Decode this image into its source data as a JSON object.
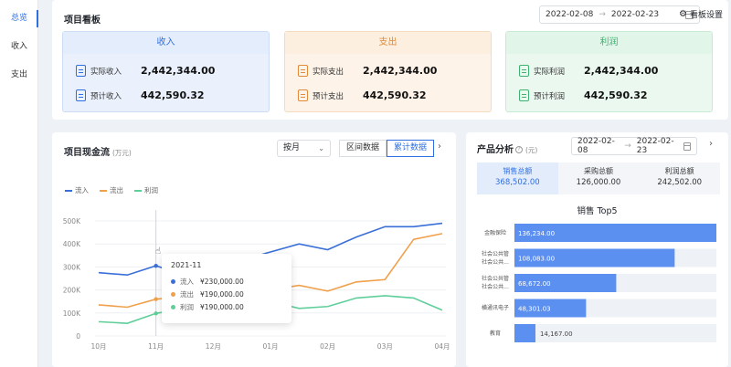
{
  "sidebar": {
    "items": [
      {
        "label": "总览",
        "active": true
      },
      {
        "label": "收入",
        "active": false
      },
      {
        "label": "支出",
        "active": false
      }
    ]
  },
  "board": {
    "title": "项目看板",
    "date_start": "2022-02-08",
    "date_end": "2022-02-23",
    "date_sep": "→",
    "settings_label": "看板设置",
    "cards": [
      {
        "title": "收入",
        "actual_label": "实际收入",
        "actual_value": "2,442,344.00",
        "plan_label": "预计收入",
        "plan_value": "442,590.32",
        "bg": "#eaf1fc",
        "head": "#e4edfb",
        "border": "#cddcf5",
        "accent": "#2f6fe0",
        "icon": "document-icon"
      },
      {
        "title": "支出",
        "actual_label": "实际支出",
        "actual_value": "2,442,344.00",
        "plan_label": "预计支出",
        "plan_value": "442,590.32",
        "bg": "#fdf3e8",
        "head": "#fcefdf",
        "border": "#f5dcbf",
        "accent": "#e08a3a",
        "icon": "document-icon"
      },
      {
        "title": "利润",
        "actual_label": "实际利润",
        "actual_value": "2,442,344.00",
        "plan_label": "预计利润",
        "plan_value": "442,590.32",
        "bg": "#eaf8ef",
        "head": "#e1f5e8",
        "border": "#c9ebd4",
        "accent": "#3cb371",
        "icon": "document-icon"
      }
    ]
  },
  "cashflow": {
    "title": "项目现金流",
    "unit": "(万元)",
    "period_select": "按月",
    "seg_interval": "区间数据",
    "seg_cumulative": "累计数据",
    "next_icon": "›",
    "tooltip": {
      "title": "2021-11",
      "rows": [
        {
          "name": "流入",
          "value": "¥230,000.00",
          "color": "#3a6fd8"
        },
        {
          "name": "流出",
          "value": "¥190,000.00",
          "color": "#f0a04b"
        },
        {
          "name": "利润",
          "value": "¥190,000.00",
          "color": "#5fcf9a"
        }
      ]
    }
  },
  "chart_data": [
    {
      "type": "line",
      "categories": [
        "10月",
        "",
        "11月",
        "",
        "12月",
        "",
        "01月",
        "",
        "02月",
        "",
        "03月",
        "",
        "04月"
      ],
      "y_ticks": [
        "0",
        "100K",
        "200K",
        "300K",
        "400K",
        "500K"
      ],
      "ylim": [
        0,
        500000
      ],
      "legend_position": "top-left",
      "series": [
        {
          "name": "流入",
          "color": "#3a6fd8",
          "values": [
            275000,
            265000,
            305000,
            265000,
            290000,
            330000,
            365000,
            400000,
            375000,
            430000,
            475000,
            475000,
            490000
          ]
        },
        {
          "name": "流出",
          "color": "#f0a04b",
          "values": [
            135000,
            125000,
            160000,
            170000,
            170000,
            180000,
            200000,
            220000,
            195000,
            235000,
            245000,
            420000,
            445000
          ]
        },
        {
          "name": "利润",
          "color": "#5fcf9a",
          "values": [
            62000,
            55000,
            98000,
            120000,
            122000,
            118000,
            150000,
            120000,
            128000,
            165000,
            175000,
            165000,
            112000
          ]
        }
      ]
    },
    {
      "type": "bar",
      "orientation": "horizontal",
      "title": "销售 Top5",
      "categories": [
        "金融保险",
        "社会公共管\n社会公共...",
        "社会公共管\n社会公共...",
        "横通讯电子",
        "教育"
      ],
      "values": [
        136234.0,
        108083.0,
        68672.0,
        48301.03,
        14167.0
      ],
      "value_labels": [
        "136,234.00",
        "108,083.00",
        "68,672.00",
        "48,301.03",
        "14,167.00"
      ],
      "color": "#5b8ff0",
      "track_color": "#eef1f6"
    }
  ],
  "product": {
    "title": "产品分析",
    "help_icon": "?",
    "unit": "(元)",
    "date_start": "2022-02-08",
    "date_end": "2022-02-23",
    "date_sep": "→",
    "next_icon": "›",
    "stats": [
      {
        "label": "销售总额",
        "value": "368,502.00",
        "active": true
      },
      {
        "label": "采购总额",
        "value": "126,000.00",
        "active": false
      },
      {
        "label": "利润总额",
        "value": "242,502.00",
        "active": false
      }
    ]
  }
}
